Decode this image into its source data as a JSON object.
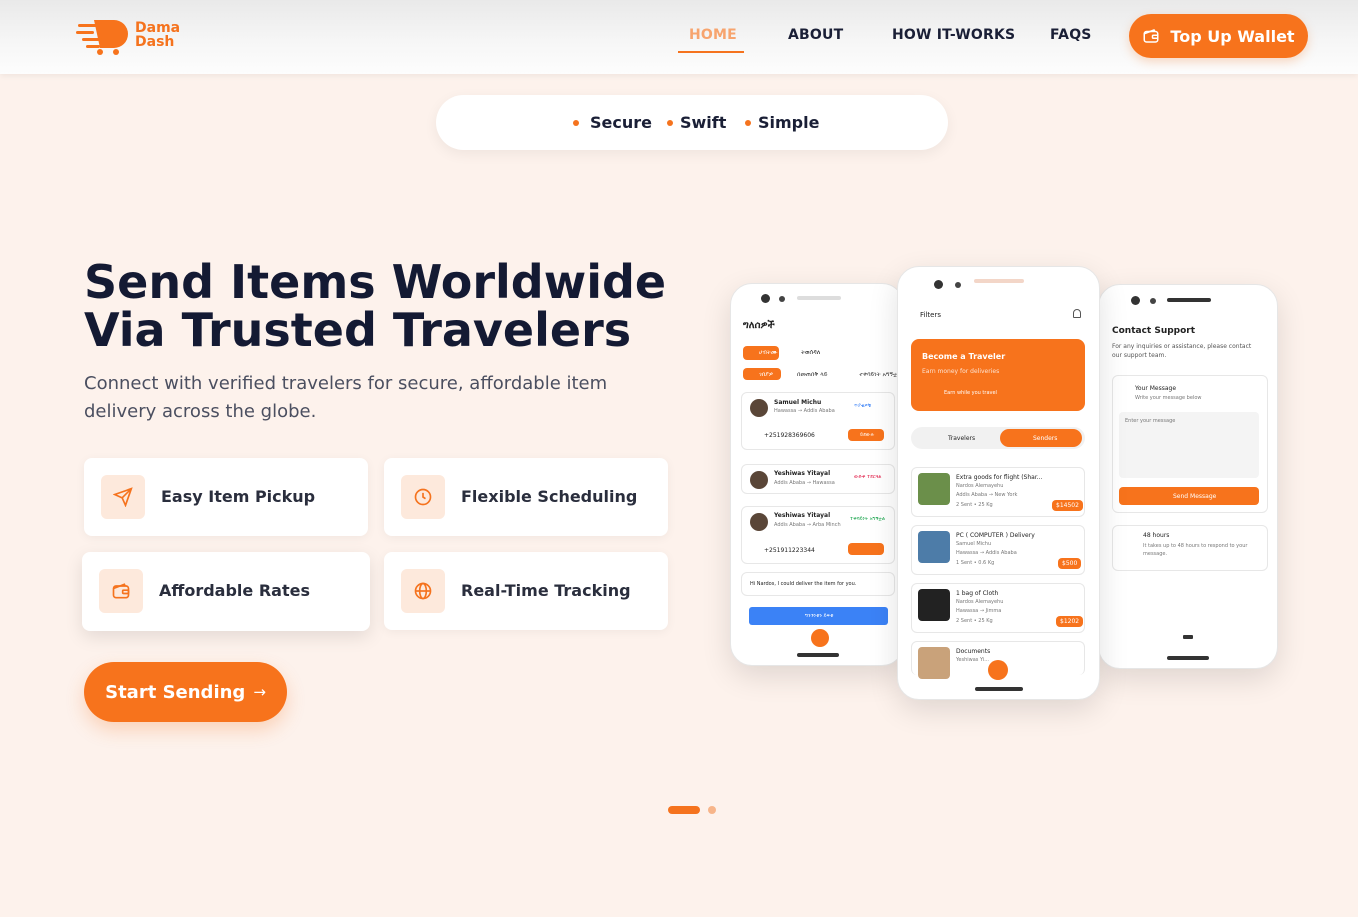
{
  "brand": {
    "name_line1": "Dama",
    "name_line2": "Dash",
    "accent": "#f7731c",
    "dark_text": "#141a33"
  },
  "nav": {
    "items": [
      {
        "label": "HOME",
        "active": true
      },
      {
        "label": "ABOUT",
        "active": false
      },
      {
        "label": "HOW IT-WORKS",
        "active": false
      },
      {
        "label": "FAQS",
        "active": false
      }
    ],
    "cta_label": "Top Up Wallet",
    "cta_icon": "wallet-icon"
  },
  "tagline_pill": [
    "Secure",
    "Swift",
    "Simple"
  ],
  "hero": {
    "headline_line1": "Send Items Worldwide",
    "headline_line2": "Via Trusted Travelers",
    "subheading": "Connect with verified travelers for secure, affordable item delivery across the globe.",
    "features": [
      {
        "label": "Easy Item Pickup",
        "icon": "send-icon"
      },
      {
        "label": "Flexible Scheduling",
        "icon": "clock-icon"
      },
      {
        "label": "Affordable Rates",
        "icon": "wallet-icon"
      },
      {
        "label": "Real-Time Tracking",
        "icon": "globe-icon"
      }
    ],
    "cta_label": "Start Sending",
    "cta_arrow": "→"
  },
  "carousel": {
    "total": 2,
    "active": 1
  },
  "phone_left": {
    "title": "ግለሰዎች",
    "tab_a": "ሀብትሙ",
    "tab_b": "ትወሰዳለ",
    "filter_a": "ገበያዎ",
    "filter_b": "በመጠበቅ ላይ",
    "filter_c": "ተቀባይነት አግኝቷል",
    "entries": [
      {
        "name": "Samuel Michu",
        "route": "Hawassa → Addis Ababa",
        "phone": "+251928369606",
        "status": "ጥያቄዎቹ"
      },
      {
        "name": "Yeshiwas Yitayal",
        "route": "Addis Ababa → Hawassa",
        "status": "ውድቅ ተደርጓል"
      },
      {
        "name": "Yeshiwas Yitayal",
        "route": "Addis Ababa → Arba Minch",
        "phone": "+251911223344",
        "status": "ተቀባይነት አግኝቷል"
      }
    ],
    "message": "Hi Nardos, I could deliver the item for you.",
    "confirm": "ግንኙነቱን ይፍቱ",
    "action_label": "ይደውሉ"
  },
  "phone_mid": {
    "filters_label": "Filters",
    "banner_title": "Become a Traveler",
    "banner_sub": "Earn money for deliveries",
    "banner_cta": "Earn while you travel",
    "toggle_a": "Travelers",
    "toggle_b": "Senders",
    "listings": [
      {
        "title": "Extra goods for flight (Shar...",
        "owner": "Nardos Alemayehu",
        "route": "Addis Ababa → New York",
        "meta": "2 Sent • 25 Kg",
        "price": "$14502"
      },
      {
        "title": "PC ( COMPUTER ) Delivery",
        "owner": "Samuel Michu",
        "route": "Hawassa → Addis Ababa",
        "meta": "1 Sent • 0.6 Kg",
        "price": "$500"
      },
      {
        "title": "1 bag of Cloth",
        "owner": "Nardos Alemayehu",
        "route": "Hawassa → Jimma",
        "meta": "2 Sent • 25 Kg",
        "price": "$1202"
      },
      {
        "title": "Documents",
        "owner": "Yeshiwas Yi...",
        "route": "",
        "meta": "",
        "price": ""
      }
    ]
  },
  "phone_right": {
    "title": "Contact Support",
    "intro": "For any inquiries or assistance, please contact our support team.",
    "msg_title": "Your Message",
    "msg_sub": "Write your message below",
    "placeholder": "Enter your message",
    "send_label": "Send Message",
    "time_title": "48 hours",
    "time_sub": "It takes up to 48 hours to respond to your message."
  }
}
